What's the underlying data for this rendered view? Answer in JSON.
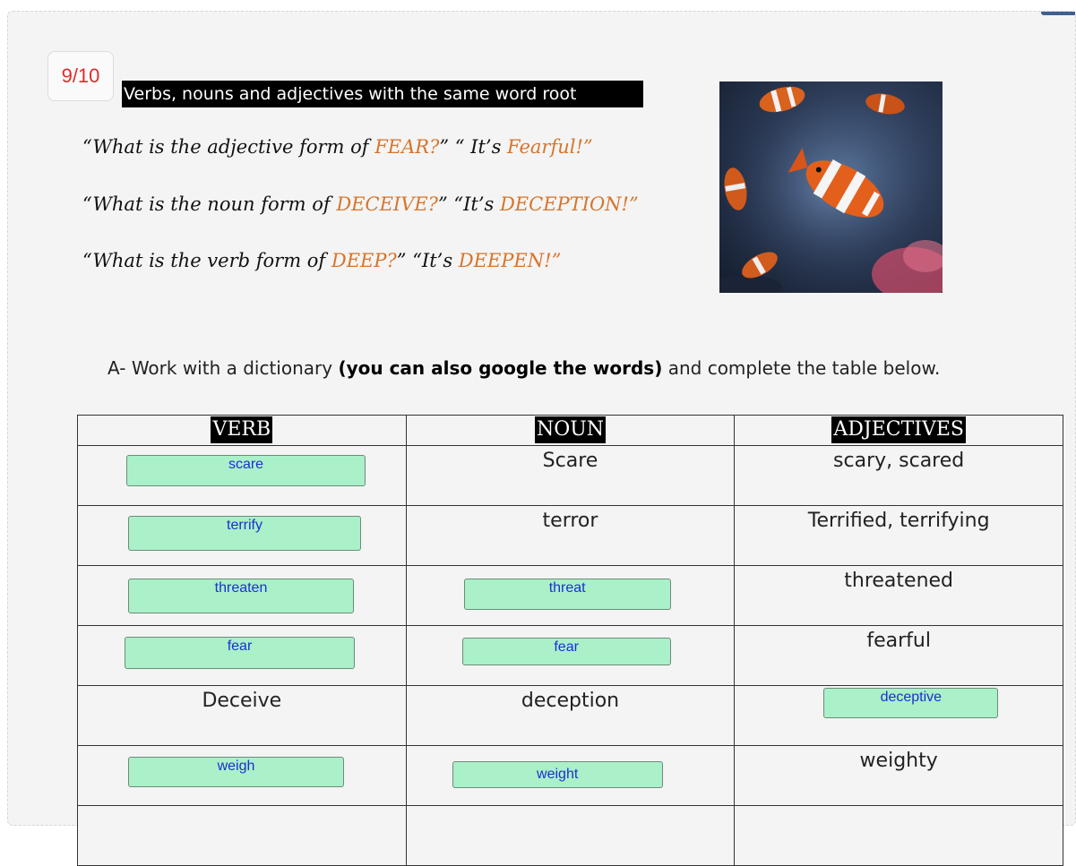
{
  "score": "9/10",
  "title": "Verbs, nouns and adjectives with the same word root",
  "examples": [
    {
      "a": "“What is the adjective form of ",
      "b": "FEAR?",
      "c": "” “ It’s ",
      "d": "Fearful!”"
    },
    {
      "a": "“What is the noun form of ",
      "b": "DECEIVE?",
      "c": "” “It’s ",
      "d": "DECEPTION!”"
    },
    {
      "a": "“What is the verb form of ",
      "b": "DEEP?",
      "c": "” “It’s ",
      "d": "DEEPEN!”"
    }
  ],
  "colors": {
    "highlight": "#d8742a",
    "answer_bg": "#aaf0c8",
    "answer_text": "#1b30d0",
    "score": "#e02b2b"
  },
  "image": {
    "icon": "clownfish-photo"
  },
  "instruction": {
    "prefix": "A- Work with a dictionary ",
    "bold": "(you can also google the words)",
    "suffix": " and complete the table below."
  },
  "table": {
    "headers": [
      "VERB",
      "NOUN",
      "ADJECTIVES"
    ],
    "rows": [
      {
        "verb": "scare",
        "noun": "Scare",
        "adj": "scary, scared"
      },
      {
        "verb": "terrify",
        "noun": "terror",
        "adj": "Terrified, terrifying"
      },
      {
        "verb": "threaten",
        "noun": "threat",
        "adj": "threatened"
      },
      {
        "verb": "fear",
        "noun": "fear",
        "adj": "fearful"
      },
      {
        "verb": "Deceive",
        "noun": "deception",
        "adj": "deceptive"
      },
      {
        "verb": "weigh",
        "noun": "weight",
        "adj": "weighty"
      }
    ]
  }
}
